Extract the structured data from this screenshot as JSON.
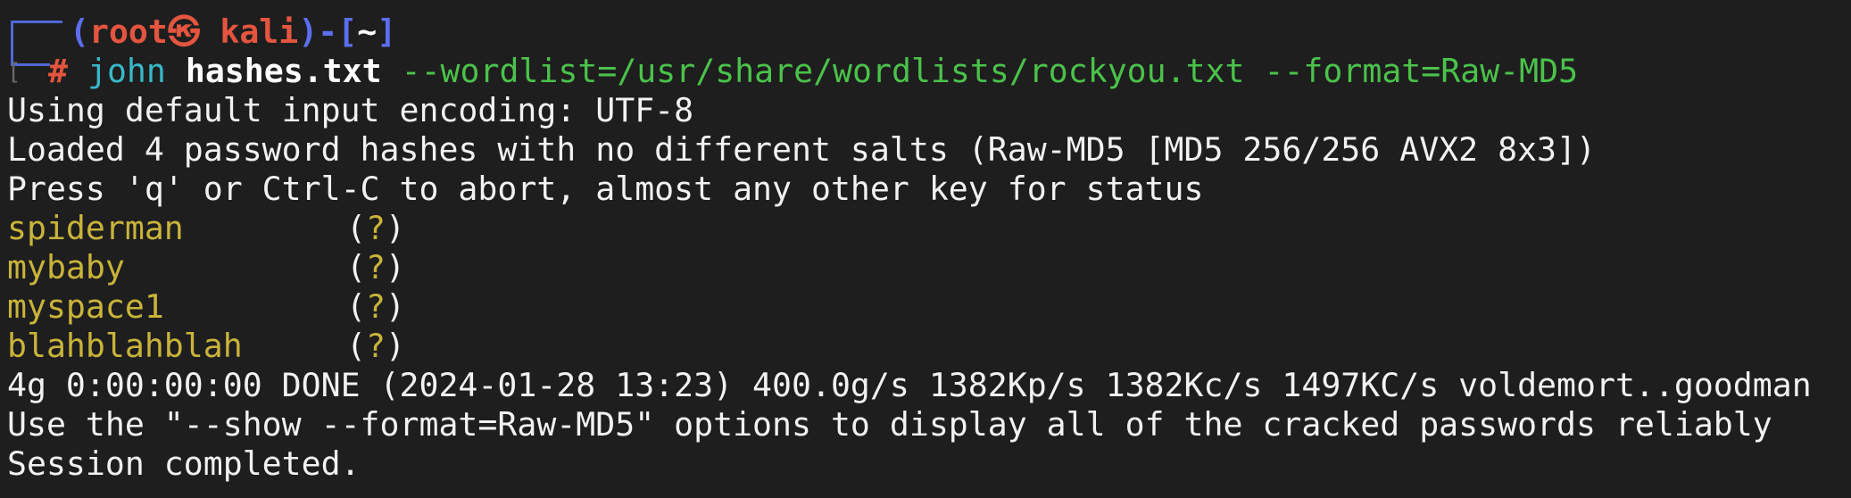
{
  "prompt": {
    "open": "(",
    "user_host": "root㉿ kali",
    "mid": ")-[",
    "cwd": "~",
    "close": "]",
    "side_bracket": "[",
    "hash": "#"
  },
  "command": {
    "program": "john",
    "file": "hashes.txt",
    "args": "--wordlist=/usr/share/wordlists/rockyou.txt --format=Raw-MD5"
  },
  "output_lines_top": [
    "Using default input encoding: UTF-8",
    "Loaded 4 password hashes with no different salts (Raw-MD5 [MD5 256/256 AVX2 8x3])",
    "Press 'q' or Ctrl-C to abort, almost any other key for status"
  ],
  "cracked": [
    {
      "password": "spiderman",
      "user": "?"
    },
    {
      "password": "mybaby",
      "user": "?"
    },
    {
      "password": "myspace1",
      "user": "?"
    },
    {
      "password": "blahblahblah",
      "user": "?"
    }
  ],
  "output_lines_bottom": [
    "4g 0:00:00:00 DONE (2024-01-28 13:23) 400.0g/s 1382Kp/s 1382Kc/s 1497KC/s voldemort..goodman",
    "Use the \"--show --format=Raw-MD5\" options to display all of the cracked passwords reliably",
    "Session completed."
  ],
  "colors": {
    "background": "#1e1e1e",
    "prompt_frame": "#4f68d9",
    "user_host": "#e4553f",
    "command": "#38b9c9",
    "args": "#4bc24b",
    "password": "#c9b43a",
    "text": "#f2f2f2"
  }
}
